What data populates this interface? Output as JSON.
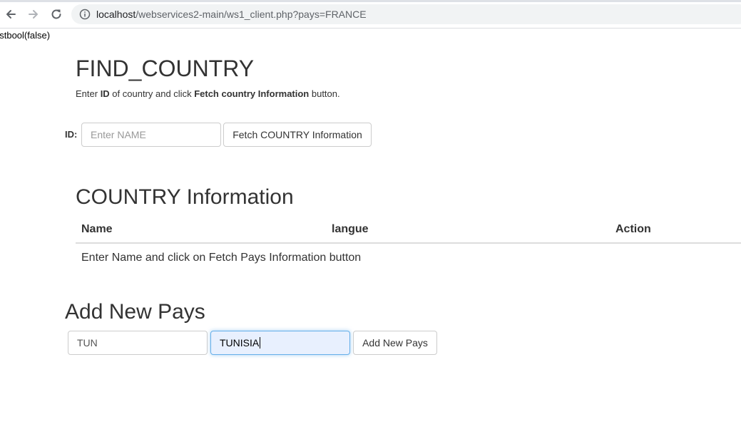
{
  "browser": {
    "url_host": "localhost",
    "url_path": "/webservices2-main/ws1_client.php?pays=FRANCE"
  },
  "debug": {
    "text": "estbool(false)"
  },
  "find": {
    "title": "FIND_COUNTRY",
    "instr_prefix": "Enter ",
    "instr_id": "ID",
    "instr_middle": " of country and click ",
    "instr_button": "Fetch country Information",
    "instr_suffix": " button.",
    "id_label": "ID:",
    "name_placeholder": "Enter NAME",
    "name_value": "",
    "fetch_label": "Fetch COUNTRY Information"
  },
  "country_info": {
    "title": "COUNTRY Information",
    "columns": [
      "Name",
      "langue",
      "Action"
    ],
    "empty_message": "Enter Name and click on Fetch Pays Information button"
  },
  "add": {
    "title": "Add New Pays",
    "code_value": "TUN",
    "name_value": "TUNISIA",
    "button_label": "Add New Pays"
  }
}
